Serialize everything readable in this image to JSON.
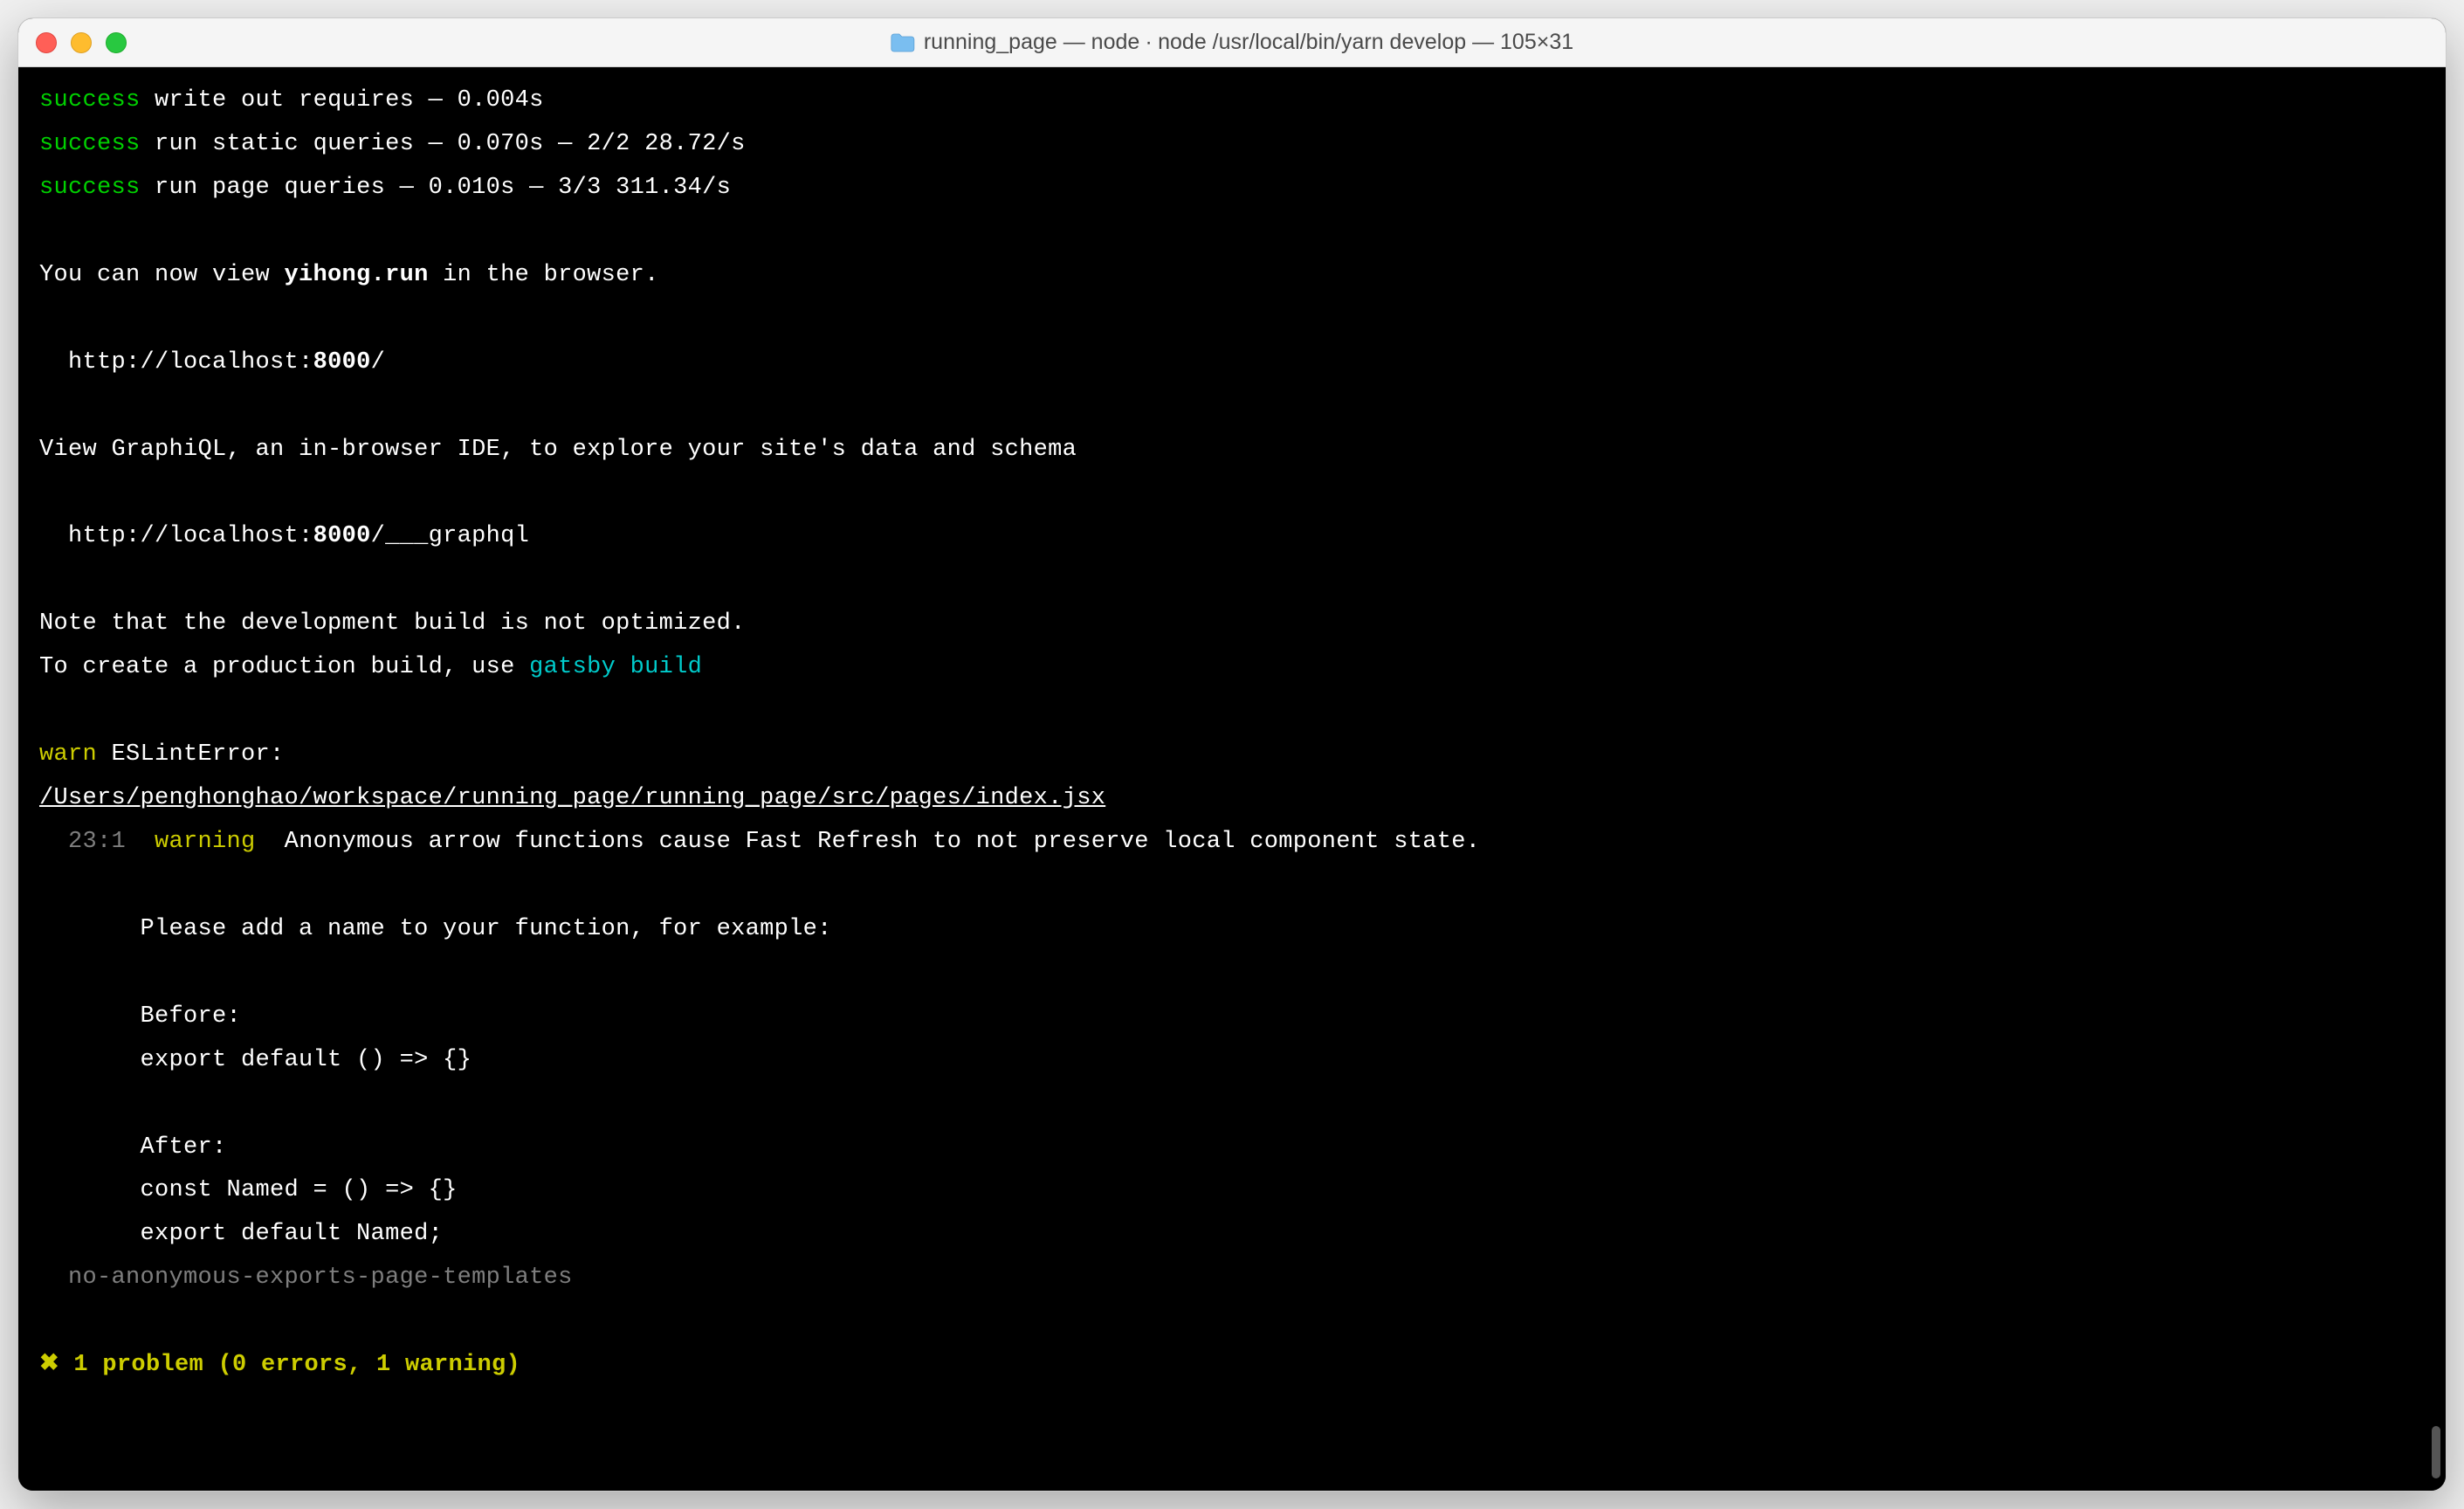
{
  "window": {
    "title": "running_page — node ∙ node /usr/local/bin/yarn develop — 105×31"
  },
  "colors": {
    "green": "#00d100",
    "white": "#ffffff",
    "grey": "#7e7e7e",
    "yellow": "#cdcd00",
    "cyan": "#00cbcb",
    "bg": "#000000"
  },
  "lines": {
    "l1_success": "success",
    "l1_rest": " write out requires — 0.004s",
    "l2_success": "success",
    "l2_rest": " run static queries — 0.070s — 2/2 28.72/s",
    "l3_success": "success",
    "l3_rest": " run page queries — 0.010s — 3/3 311.34/s",
    "blank": "",
    "view_prefix": "You can now view ",
    "site_name": "yihong.run",
    "view_suffix": " in the browser.",
    "url1_prefix": "  http://localhost:",
    "url1_port": "8000",
    "url1_suffix": "/",
    "graphiql": "View GraphiQL, an in-browser IDE, to explore your site's data and schema",
    "url2_prefix": "  http://localhost:",
    "url2_port": "8000",
    "url2_suffix": "/___graphql",
    "note": "Note that the development build is not optimized.",
    "prod_prefix": "To create a production build, use ",
    "gatsby_build": "gatsby build",
    "warn": "warn",
    "eslint": " ESLintError:",
    "path": "/Users/penghonghao/workspace/running_page/running_page/src/pages/index.jsx",
    "loc": "  23:1",
    "warning_label": "  warning",
    "warning_msg": "  Anonymous arrow functions cause Fast Refresh to not preserve local component state.",
    "please": "       Please add a name to your function, for example:",
    "before_label": "       Before:",
    "before_code": "       export default () => {}",
    "after_label": "       After:",
    "after_code1": "       const Named = () => {}",
    "after_code2": "       export default Named;",
    "rule": "  no-anonymous-exports-page-templates",
    "summary": "✖ 1 problem (0 errors, 1 warning)"
  }
}
